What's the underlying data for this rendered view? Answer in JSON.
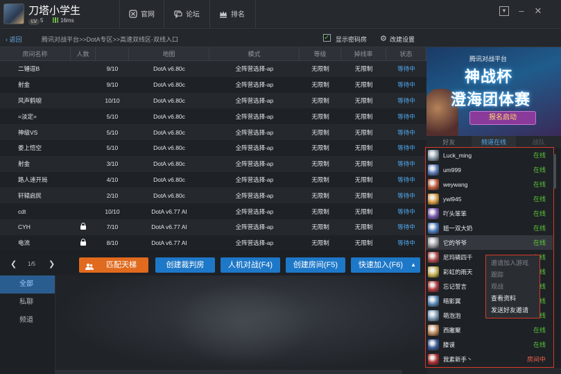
{
  "header": {
    "username": "刀塔小学生",
    "level_badge": "LV",
    "level": "5",
    "ping": "16ms",
    "nav": [
      {
        "label": "官网",
        "icon": "tencent-icon"
      },
      {
        "label": "论坛",
        "icon": "forum-icon"
      },
      {
        "label": "排名",
        "icon": "crown-icon"
      }
    ]
  },
  "toolbar": {
    "back": "返回",
    "breadcrumb": "腾讯对战平台>>DotA专区>>高速双线区-双线入口",
    "show_pw_rooms": "显示密码房",
    "show_pw_checked": true,
    "settings": "改建设置"
  },
  "table": {
    "headers": [
      "房间名称",
      "人数",
      "地图",
      "模式",
      "等级",
      "掉线率",
      "状态"
    ],
    "rows": [
      {
        "name": "二锤逗B",
        "lock": false,
        "players": "9/10",
        "map": "DotA v6.80c",
        "mode": "全阵营选择-ap",
        "level": "无限制",
        "drop": "无限制",
        "status": "等待中"
      },
      {
        "name": "射金",
        "lock": false,
        "players": "9/10",
        "map": "DotA v6.80c",
        "mode": "全阵营选择-ap",
        "level": "无限制",
        "drop": "无限制",
        "status": "等待中"
      },
      {
        "name": "风声鹤唳",
        "lock": false,
        "players": "10/10",
        "map": "DotA v6.80c",
        "mode": "全阵营选择-ap",
        "level": "无限制",
        "drop": "无限制",
        "status": "等待中"
      },
      {
        "name": "=淡定=",
        "lock": false,
        "players": "5/10",
        "map": "DotA v6.80c",
        "mode": "全阵营选择-ap",
        "level": "无限制",
        "drop": "无限制",
        "status": "等待中"
      },
      {
        "name": "神级VS",
        "lock": false,
        "players": "5/10",
        "map": "DotA v6.80c",
        "mode": "全阵营选择-ap",
        "level": "无限制",
        "drop": "无限制",
        "status": "等待中"
      },
      {
        "name": "娄上悟空",
        "lock": false,
        "players": "5/10",
        "map": "DotA v6.80c",
        "mode": "全阵营选择-ap",
        "level": "无限制",
        "drop": "无限制",
        "status": "等待中"
      },
      {
        "name": "射金",
        "lock": false,
        "players": "3/10",
        "map": "DotA v6.80c",
        "mode": "全阵营选择-ap",
        "level": "无限制",
        "drop": "无限制",
        "status": "等待中"
      },
      {
        "name": "路人速开局",
        "lock": false,
        "players": "4/10",
        "map": "DotA v6.80c",
        "mode": "全阵营选择-ap",
        "level": "无限制",
        "drop": "无限制",
        "status": "等待中"
      },
      {
        "name": "轩辕启民",
        "lock": false,
        "players": "2/10",
        "map": "DotA v6.80c",
        "mode": "全阵营选择-ap",
        "level": "无限制",
        "drop": "无限制",
        "status": "等待中"
      },
      {
        "name": "cdt",
        "lock": false,
        "players": "10/10",
        "map": "DotA v6.77 AI",
        "mode": "全阵营选择-ap",
        "level": "无限制",
        "drop": "无限制",
        "status": "等待中"
      },
      {
        "name": "CYH",
        "lock": true,
        "players": "7/10",
        "map": "DotA v6.77 AI",
        "mode": "全阵营选择-ap",
        "level": "无限制",
        "drop": "无限制",
        "status": "等待中"
      },
      {
        "name": "电流",
        "lock": true,
        "players": "8/10",
        "map": "DotA v6.77 AI",
        "mode": "全阵营选择-ap",
        "level": "无限制",
        "drop": "无限制",
        "status": "等待中"
      }
    ]
  },
  "pager": {
    "text": "1/5"
  },
  "buttons": {
    "match": "匹配天梯",
    "referee": "创建裁判房",
    "ai": "人机对战(F4)",
    "create": "创建房间(F5)",
    "quick": "快速加入(F6)"
  },
  "chat": {
    "tabs": [
      "全部",
      "私聊",
      "频道"
    ]
  },
  "banner": {
    "line1": "腾讯对战平台",
    "line2": "神战杯",
    "line3": "澄海团体赛",
    "line4": "报名启动"
  },
  "friends": {
    "tabs": [
      "好友",
      "频道在线",
      "战队"
    ],
    "list": [
      {
        "name": "Luck_ming",
        "status": "在线",
        "color": "#8a9aa8"
      },
      {
        "name": "um999",
        "status": "在线",
        "color": "#5a7ab8"
      },
      {
        "name": "weywang",
        "status": "在线",
        "color": "#c05a3a"
      },
      {
        "name": "ywl945",
        "status": "在线",
        "color": "#d89a40"
      },
      {
        "name": "吖头笨笨",
        "status": "在线",
        "color": "#7a5ab0"
      },
      {
        "name": "姐一双大奶",
        "status": "在线",
        "color": "#4a7ac0"
      },
      {
        "name": "它的爷爷",
        "status": "在线",
        "color": "#9a9aa0"
      },
      {
        "name": "尼玛磷四千",
        "status": "在线",
        "color": "#b04a4a"
      },
      {
        "name": "彩虹的雨天",
        "status": "在线",
        "color": "#c8b050"
      },
      {
        "name": "忘记誓言",
        "status": "在线",
        "color": "#b03a3a"
      },
      {
        "name": "暗影翼",
        "status": "在线",
        "color": "#5a8ab8"
      },
      {
        "name": "萌泡泡",
        "status": "在线",
        "color": "#7a9ab8"
      },
      {
        "name": "西撇聚",
        "status": "在线",
        "color": "#c08a5a"
      },
      {
        "name": "滕谟",
        "status": "在线",
        "color": "#3a5a9a"
      },
      {
        "name": "我素新手丶",
        "status": "房间中",
        "color": "#b03030"
      }
    ]
  },
  "context_menu": [
    {
      "label": "邀请加入游戏",
      "enabled": false
    },
    {
      "label": "跟踪",
      "enabled": false
    },
    {
      "label": "观战",
      "enabled": false
    },
    {
      "label": "查看资料",
      "enabled": true
    },
    {
      "label": "发送好友邀请",
      "enabled": true
    }
  ]
}
